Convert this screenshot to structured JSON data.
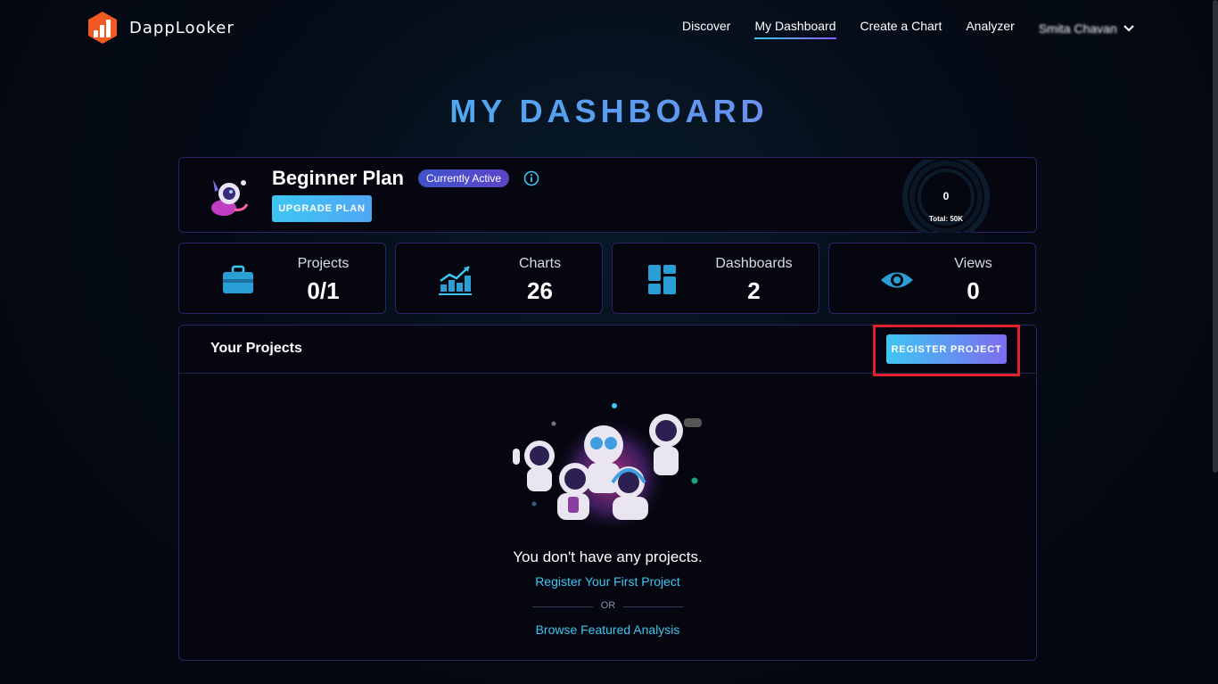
{
  "header": {
    "brand": "DappLooker",
    "nav": [
      {
        "label": "Discover",
        "active": false
      },
      {
        "label": "My Dashboard",
        "active": true
      },
      {
        "label": "Create a Chart",
        "active": false
      },
      {
        "label": "Analyzer",
        "active": false
      }
    ],
    "user_name": "Smita Chavan"
  },
  "page_title": "MY DASHBOARD",
  "plan": {
    "name": "Beginner Plan",
    "status_badge": "Currently Active",
    "upgrade_label": "UPGRADE PLAN",
    "usage_value": "0",
    "usage_total": "Total: 50K",
    "usage_fraction": 0
  },
  "stats": [
    {
      "label": "Projects",
      "value": "0/1",
      "icon": "briefcase-icon"
    },
    {
      "label": "Charts",
      "value": "26",
      "icon": "chart-growth-icon"
    },
    {
      "label": "Dashboards",
      "value": "2",
      "icon": "dashboard-grid-icon"
    },
    {
      "label": "Views",
      "value": "0",
      "icon": "eye-icon"
    }
  ],
  "projects": {
    "title": "Your Projects",
    "register_label": "REGISTER PROJECT",
    "empty_message": "You don't have any projects.",
    "register_first_link": "Register Your First Project",
    "or_text": "OR",
    "browse_link": "Browse Featured Analysis"
  },
  "colors": {
    "accent_cyan": "#3fc6f2",
    "accent_purple": "#8a5cf6",
    "highlight_red": "#e0212b",
    "card_border": "#2a2363"
  }
}
